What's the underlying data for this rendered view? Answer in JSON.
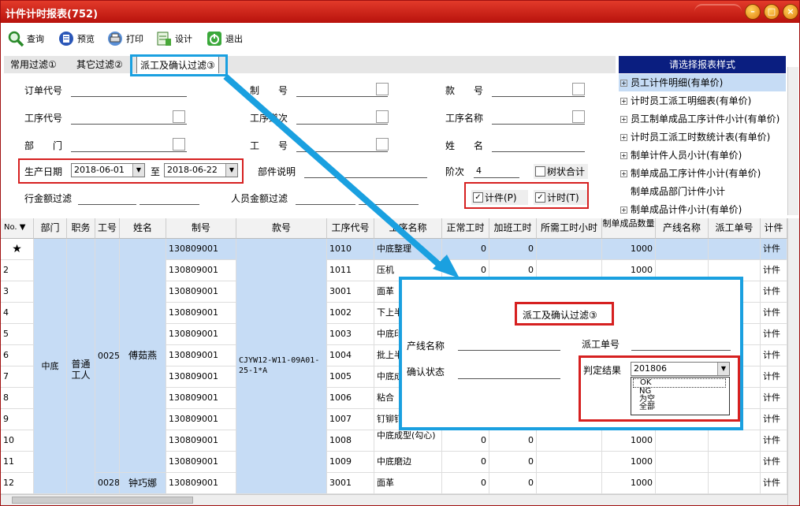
{
  "window": {
    "title": "计件计时报表(752)"
  },
  "toolbar": {
    "query": "查询",
    "preview": "预览",
    "print": "打印",
    "design": "设计",
    "exit": "退出"
  },
  "tabs": [
    "常用过滤①",
    "其它过滤②",
    "派工及确认过滤③"
  ],
  "filters": {
    "order_no": "订单代号",
    "make_no": "制　　号",
    "style_no": "款　　号",
    "process_code": "工序代号",
    "process_type": "工序道次",
    "process_name": "工序名称",
    "dept": "部　　门",
    "emp_no": "工　　号",
    "name": "姓　　名",
    "prod_date": "生产日期",
    "date_from": "2018-06-01",
    "to": "至",
    "date_to": "2018-06-22",
    "part_desc": "部件说明",
    "shift": "阶次",
    "shift_value": "4",
    "tree_total": "树状合计",
    "row_amount": "行金额过滤",
    "person_amount": "人员金额过滤",
    "piece": "计件(P)",
    "time": "计时(T)"
  },
  "report": {
    "header": "请选择报表样式",
    "items": [
      "员工计件明细(有单价)",
      "计时员工派工明细表(有单价)",
      "员工制单成品工序计件小计(有单价)",
      "计时员工派工时数统计表(有单价)",
      "制单计件人员小计(有单价)",
      "制单成品工序计件小计(有单价)",
      "制单成品部门计件小计",
      "制单成品计件小计(有单价)"
    ]
  },
  "grid": {
    "columns": [
      "No.",
      "部门",
      "职务",
      "工号",
      "姓名",
      "制号",
      "款号",
      "工序代号",
      "工序名称",
      "正常工时",
      "加班工时",
      "所需工时小时",
      "制单成品数量",
      "产线名称",
      "派工单号",
      "计件"
    ],
    "star": "★",
    "dept": "中底",
    "role": "普通工人",
    "emp1": "0025",
    "name1": "傅茹燕",
    "emp2": "0028",
    "name2": "钟巧娜",
    "style": "CJYW12-W11-09A01-25-1*A",
    "rows": [
      {
        "no": "",
        "mk": "130809001",
        "code": "1010",
        "proc": "中底整理",
        "n": "0",
        "o": "0",
        "q": "1000",
        "t": "计件"
      },
      {
        "no": "2",
        "mk": "130809001",
        "code": "1011",
        "proc": "压机",
        "n": "0",
        "o": "0",
        "q": "1000",
        "t": "计件"
      },
      {
        "no": "3",
        "mk": "130809001",
        "code": "3001",
        "proc": "面革",
        "n": "",
        "o": "",
        "q": "",
        "t": "计件"
      },
      {
        "no": "4",
        "mk": "130809001",
        "code": "1002",
        "proc": "下上半",
        "n": "",
        "o": "",
        "q": "",
        "t": "计件"
      },
      {
        "no": "5",
        "mk": "130809001",
        "code": "1003",
        "proc": "中底印",
        "n": "",
        "o": "",
        "q": "",
        "t": "计件"
      },
      {
        "no": "6",
        "mk": "130809001",
        "code": "1004",
        "proc": "批上半",
        "n": "",
        "o": "",
        "q": "",
        "t": "计件"
      },
      {
        "no": "7",
        "mk": "130809001",
        "code": "1005",
        "proc": "中底成一次",
        "n": "",
        "o": "",
        "q": "",
        "t": "计件"
      },
      {
        "no": "8",
        "mk": "130809001",
        "code": "1006",
        "proc": "粘合",
        "n": "",
        "o": "",
        "q": "",
        "t": "计件"
      },
      {
        "no": "9",
        "mk": "130809001",
        "code": "1007",
        "proc": "钉铆钉",
        "n": "",
        "o": "",
        "q": "",
        "t": "计件"
      },
      {
        "no": "10",
        "mk": "130809001",
        "code": "1008",
        "proc": "中底成型(勾心)",
        "n": "0",
        "o": "0",
        "q": "1000",
        "t": "计件"
      },
      {
        "no": "11",
        "mk": "130809001",
        "code": "1009",
        "proc": "中底磨边",
        "n": "0",
        "o": "0",
        "q": "1000",
        "t": "计件"
      },
      {
        "no": "12",
        "mk": "130809001",
        "code": "3001",
        "proc": "面革",
        "n": "0",
        "o": "0",
        "q": "1000",
        "t": "计件"
      }
    ]
  },
  "popup": {
    "title": "派工及确认过滤③",
    "line_name": "产线名称",
    "dispatch_no": "派工单号",
    "confirm": "确认状态",
    "result": "判定结果",
    "result_value": "201806",
    "options": [
      "OK",
      "NG",
      "为空",
      "全部"
    ]
  },
  "colors": {
    "title_red": "#c8180e",
    "selected_blue": "#c6dcf5",
    "highlight_blue": "#1aa0e0",
    "highlight_red": "#d62020",
    "header_navy": "#0a1e80"
  }
}
